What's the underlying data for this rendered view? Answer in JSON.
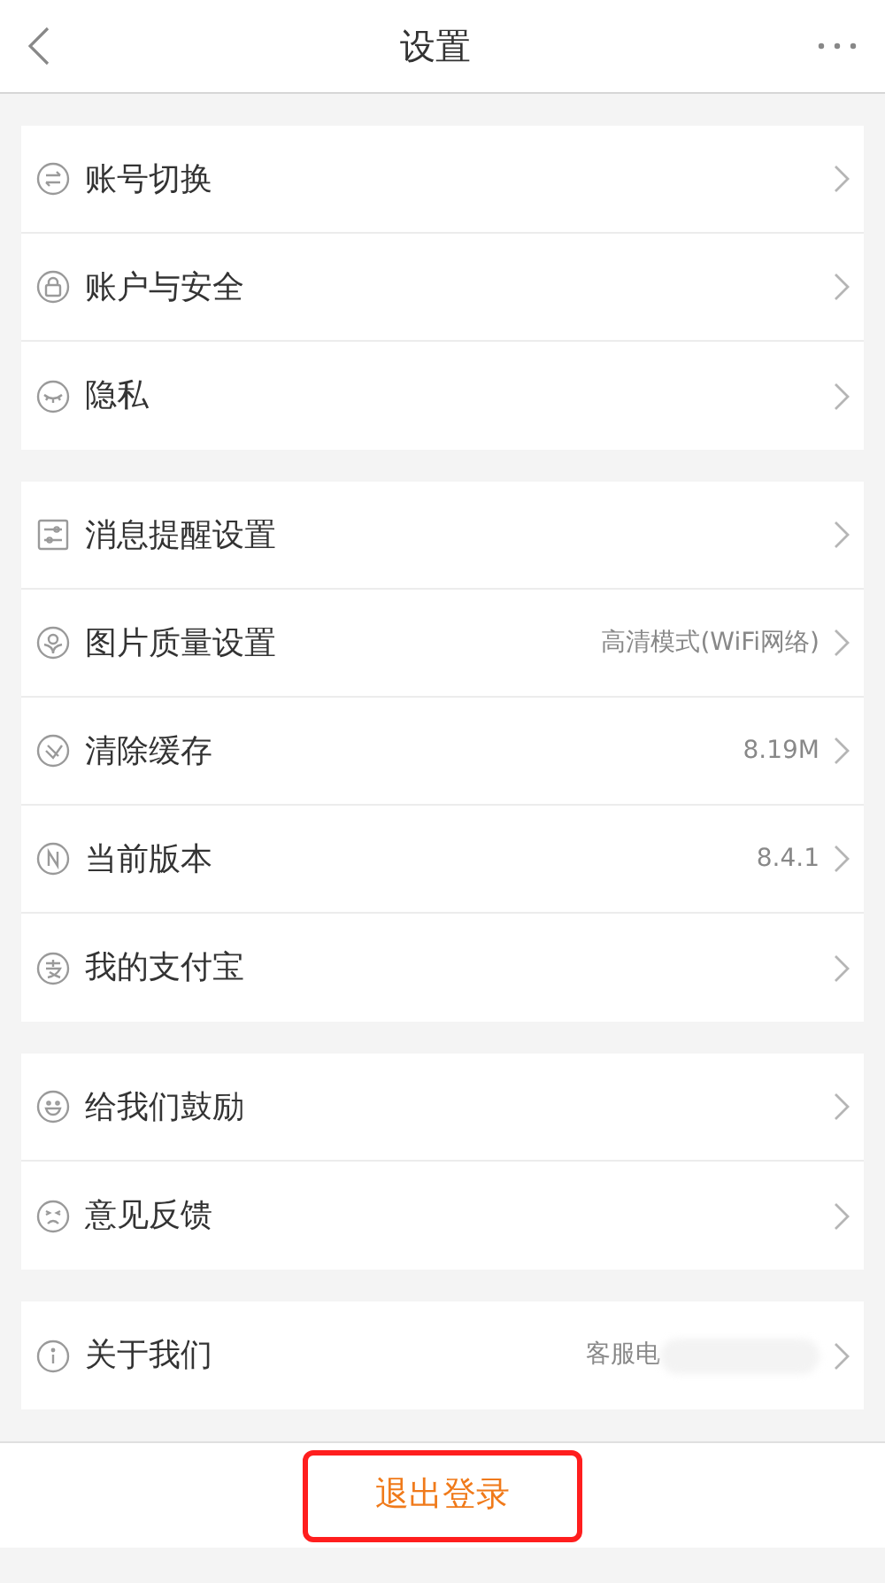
{
  "header": {
    "title": "设置"
  },
  "groups": [
    {
      "rows": [
        {
          "label": "账号切换"
        },
        {
          "label": "账户与安全"
        },
        {
          "label": "隐私"
        }
      ]
    },
    {
      "rows": [
        {
          "label": "消息提醒设置"
        },
        {
          "label": "图片质量设置",
          "value": "高清模式(WiFi网络)"
        },
        {
          "label": "清除缓存",
          "value": "8.19M"
        },
        {
          "label": "当前版本",
          "value": "8.4.1"
        },
        {
          "label": "我的支付宝"
        }
      ]
    },
    {
      "rows": [
        {
          "label": "给我们鼓励"
        },
        {
          "label": "意见反馈"
        }
      ]
    },
    {
      "rows": [
        {
          "label": "关于我们",
          "value": "客服电",
          "redacted": true
        }
      ]
    }
  ],
  "logout": {
    "label": "退出登录",
    "highlighted": true
  }
}
